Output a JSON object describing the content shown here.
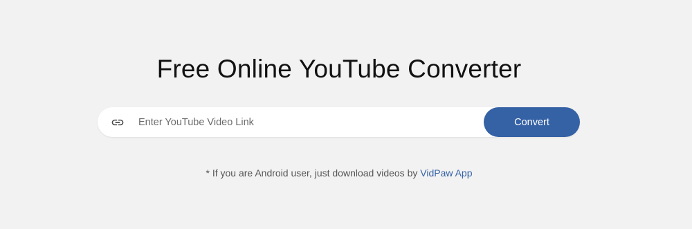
{
  "header": {
    "title": "Free Online YouTube Converter"
  },
  "search": {
    "placeholder": "Enter YouTube Video Link",
    "value": "",
    "icon": "link-icon",
    "convert_label": "Convert"
  },
  "footer_note": {
    "text": "* If you are Android user, just download videos by",
    "link_label": "VidPaw App"
  },
  "colors": {
    "background": "#f2f2f2",
    "accent": "#3561a5",
    "title": "#111111",
    "note_text": "#555555"
  }
}
